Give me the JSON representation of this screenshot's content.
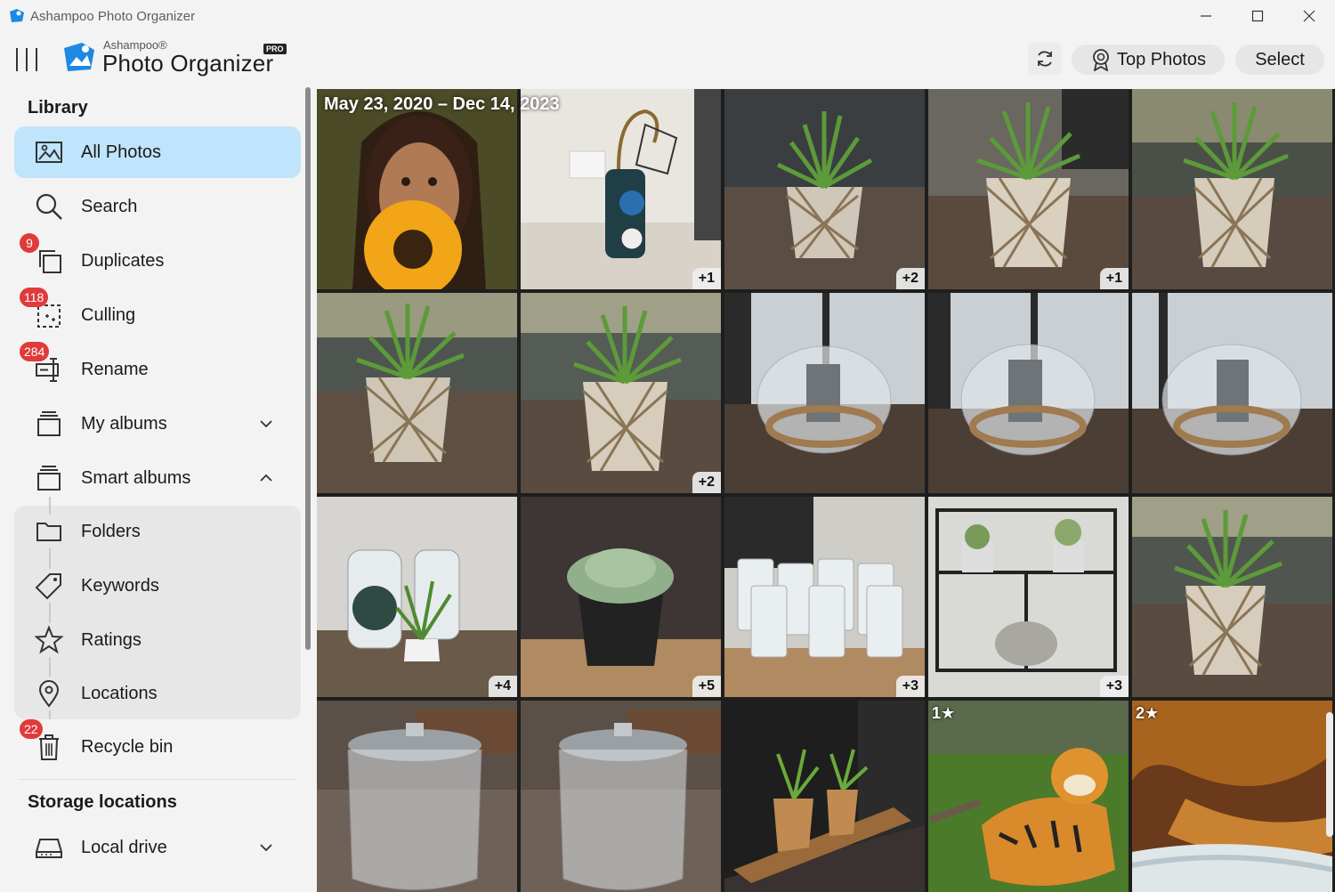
{
  "window": {
    "title": "Ashampoo Photo Organizer"
  },
  "header": {
    "brand_small": "Ashampoo®",
    "brand_name": "Photo Organizer",
    "pro_badge": "PRO",
    "top_photos_label": "Top Photos",
    "select_label": "Select"
  },
  "sidebar": {
    "library_title": "Library",
    "items": [
      {
        "label": "All Photos",
        "icon": "photos-icon",
        "active": true
      },
      {
        "label": "Search",
        "icon": "search-icon"
      },
      {
        "label": "Duplicates",
        "icon": "duplicates-icon",
        "badge": "9"
      },
      {
        "label": "Culling",
        "icon": "culling-icon",
        "badge": "118"
      },
      {
        "label": "Rename",
        "icon": "rename-icon",
        "badge": "284"
      },
      {
        "label": "My albums",
        "icon": "album-icon",
        "expand": "chevron-down"
      },
      {
        "label": "Smart albums",
        "icon": "album-icon",
        "expand": "chevron-up"
      }
    ],
    "smart_albums": [
      {
        "label": "Folders",
        "icon": "folder-icon"
      },
      {
        "label": "Keywords",
        "icon": "tag-icon"
      },
      {
        "label": "Ratings",
        "icon": "star-icon"
      },
      {
        "label": "Locations",
        "icon": "location-pin-icon"
      }
    ],
    "recycle": {
      "label": "Recycle bin",
      "icon": "trash-icon",
      "badge": "22"
    },
    "storage_title": "Storage locations",
    "storage_items": [
      {
        "label": "Local drive",
        "icon": "drive-icon",
        "expand": "chevron-down"
      }
    ]
  },
  "gallery": {
    "date_range": "May 23, 2020 – Dec 14, 2023",
    "tiles": [
      {
        "subject": "woman-with-sunflower",
        "count": ""
      },
      {
        "subject": "vintage-lamp-clock",
        "count": "+1"
      },
      {
        "subject": "aloe-plant-basket",
        "count": "+2"
      },
      {
        "subject": "aloe-plant-basket",
        "count": "+1"
      },
      {
        "subject": "aloe-plant-basket",
        "count": ""
      },
      {
        "subject": "aloe-plant-basket",
        "count": ""
      },
      {
        "subject": "aloe-plant-basket",
        "count": "+2"
      },
      {
        "subject": "glass-lantern-rope",
        "count": ""
      },
      {
        "subject": "glass-lantern-rope",
        "count": ""
      },
      {
        "subject": "glass-lantern-rope",
        "count": ""
      },
      {
        "subject": "glass-bottles-plant",
        "count": "+4"
      },
      {
        "subject": "succulent-black-pot",
        "count": "+5"
      },
      {
        "subject": "drinking-glasses",
        "count": "+3"
      },
      {
        "subject": "wall-shelf-decor",
        "count": "+3"
      },
      {
        "subject": "aloe-plant-basket",
        "count": ""
      },
      {
        "subject": "glass-jar-lid",
        "count": ""
      },
      {
        "subject": "glass-jar-lid",
        "count": ""
      },
      {
        "subject": "plants-on-tray",
        "count": ""
      },
      {
        "subject": "tiger-on-grass",
        "count": "",
        "rating": "1★"
      },
      {
        "subject": "rock-cave",
        "count": "",
        "rating": "2★"
      }
    ]
  },
  "colors": {
    "accent": "#bfe4fb",
    "badge": "#e03a3a",
    "background": "#f3f3f3"
  }
}
